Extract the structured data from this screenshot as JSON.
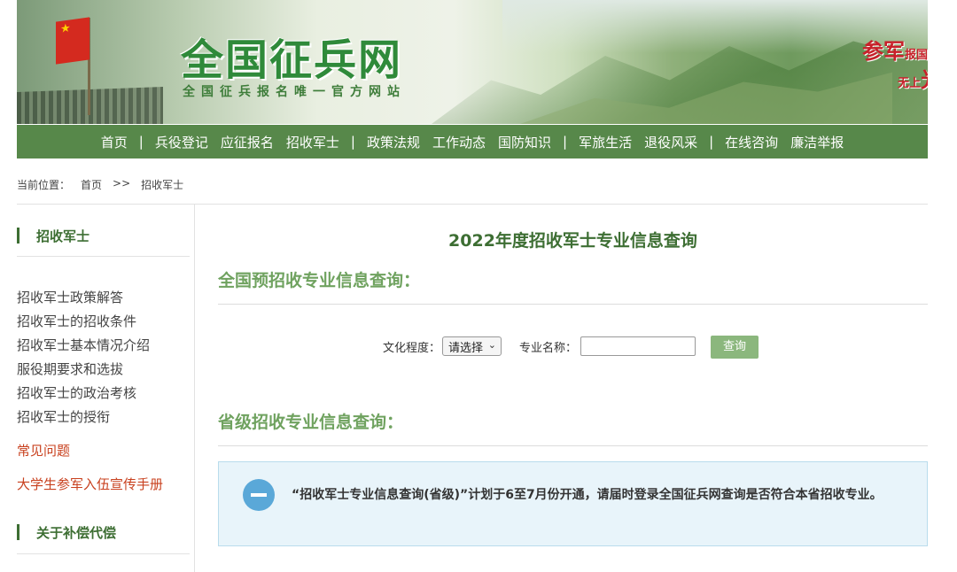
{
  "header": {
    "site_title": "全国征兵网",
    "site_subtitle": "全国征兵报名唯一官方网站",
    "slogan": {
      "part1": "参军",
      "part2": "报国",
      "part3": "无上",
      "part4": "光荣"
    }
  },
  "nav": {
    "items": [
      "首页",
      "兵役登记",
      "应征报名",
      "招收军士",
      "政策法规",
      "工作动态",
      "国防知识",
      "军旅生活",
      "退役风采",
      "在线咨询",
      "廉洁举报"
    ],
    "separator": "|"
  },
  "breadcrumb": {
    "label": "当前位置：",
    "home": "首页",
    "arrow": ">>",
    "current": "招收军士"
  },
  "sidebar": {
    "heading1": "招收军士",
    "links": [
      "招收军士政策解答",
      "招收军士的招收条件",
      "招收军士基本情况介绍",
      "服役期要求和选拔",
      "招收军士的政治考核",
      "招收军士的授衔"
    ],
    "red_link1": "常见问题",
    "red_link2": "大学生参军入伍宣传手册",
    "heading2": "关于补偿代偿"
  },
  "main": {
    "title": "2022年度招收军士专业信息查询",
    "section1_title": "全国预招收专业信息查询：",
    "form": {
      "education_label": "文化程度：",
      "education_value": "请选择",
      "major_label": "专业名称：",
      "major_value": "",
      "query_button": "查询"
    },
    "section2_title": "省级招收专业信息查询：",
    "notice": "“招收军士专业信息查询(省级)”计划于6至7月份开通，请届时登录全国征兵网查询是否符合本省招收专业。"
  },
  "colors": {
    "nav_green": "#57884a",
    "title_green": "#3d6e33",
    "section_green": "#6fa25f",
    "red_link": "#c8401e",
    "notice_bg": "#e8f4fa",
    "notice_icon": "#5aa8d8"
  },
  "icons": [
    "flag-icon",
    "minus-circle-icon",
    "chevron-down-icon"
  ]
}
